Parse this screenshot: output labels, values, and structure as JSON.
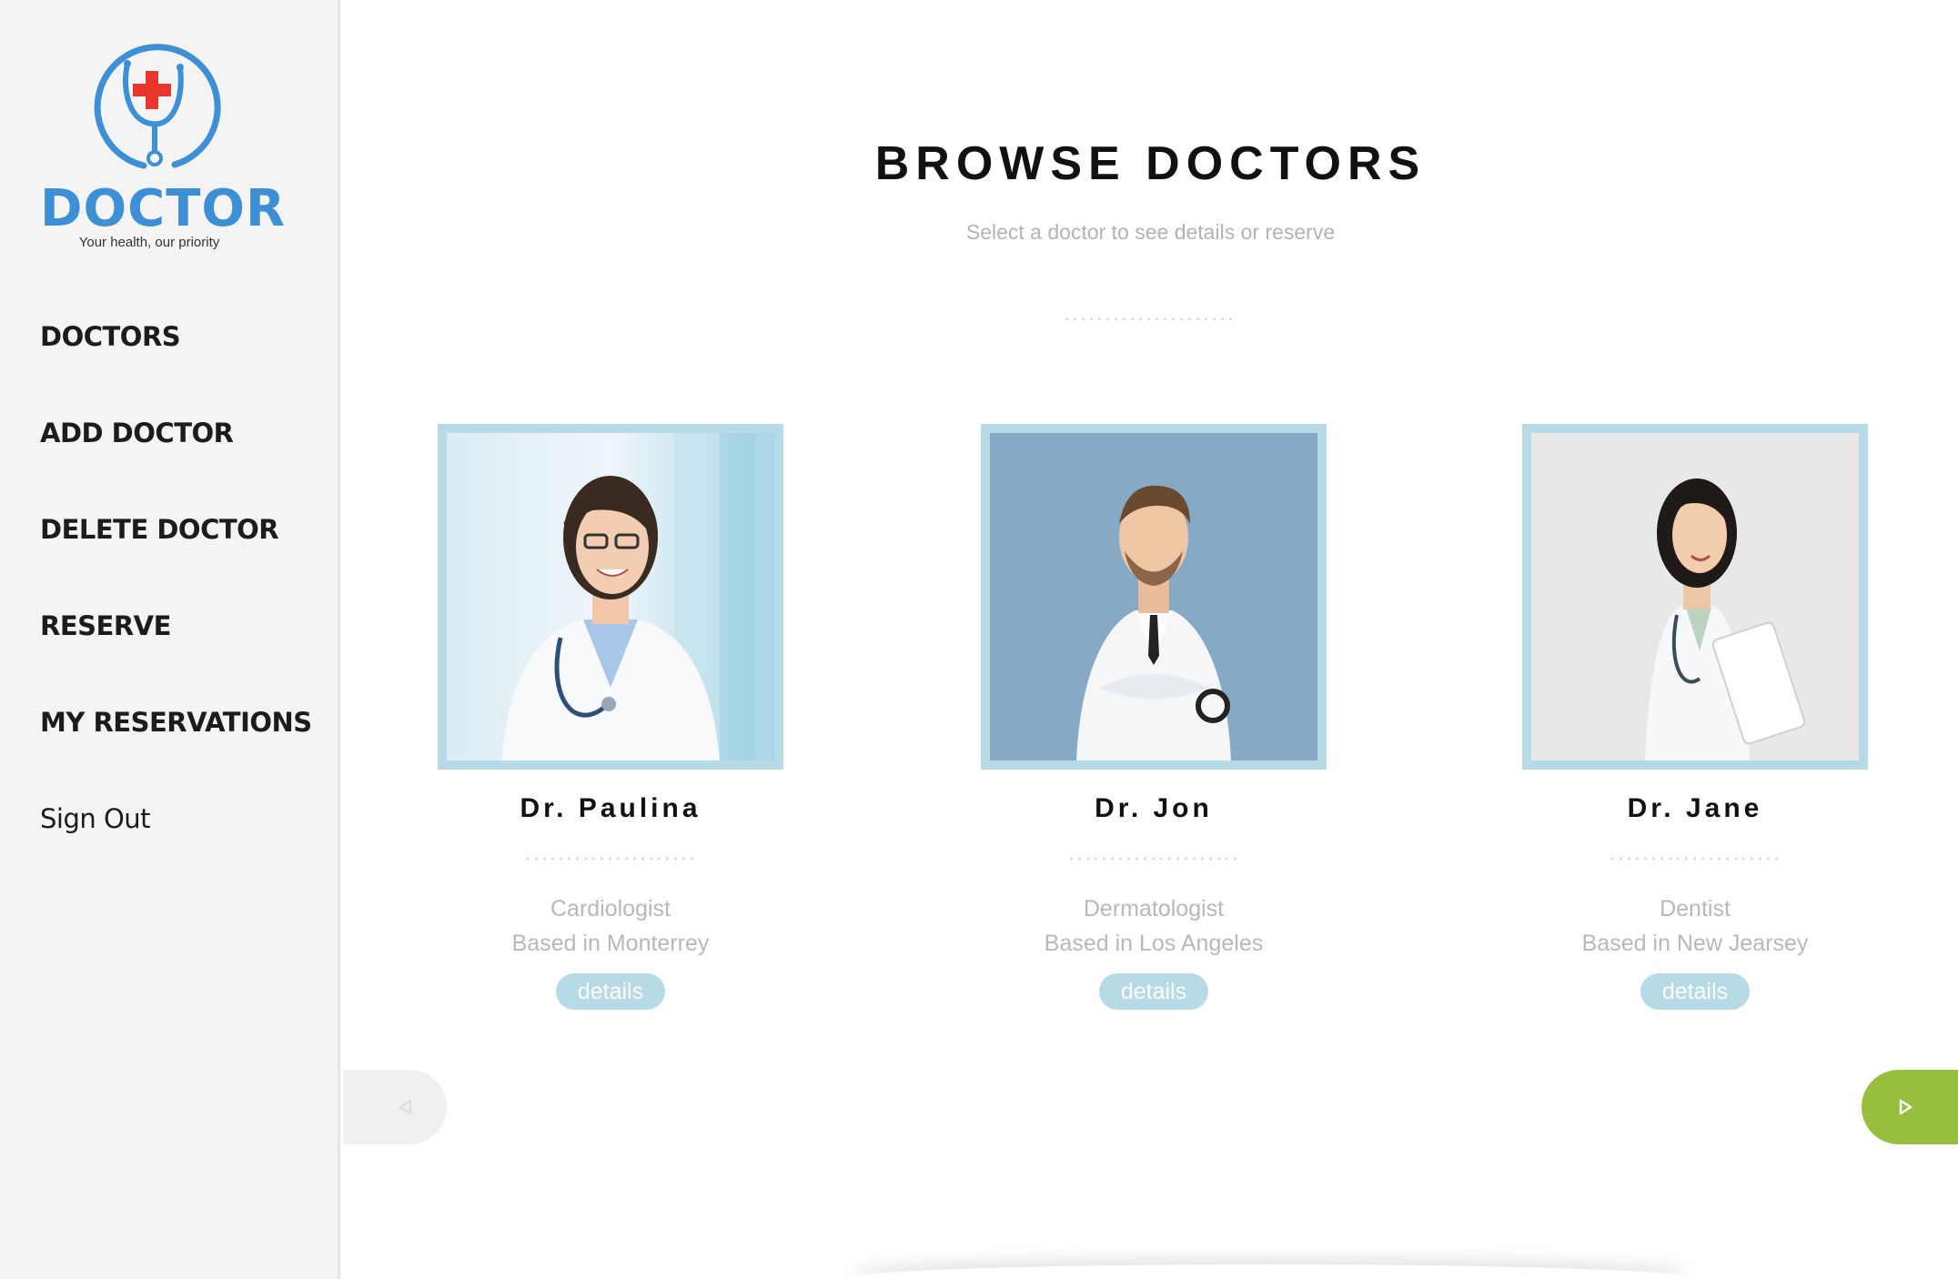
{
  "brand": {
    "name": "DOCTOR",
    "tagline": "Your health, our priority",
    "color": "#3d8fd6",
    "cross_color": "#e8362d"
  },
  "sidebar": {
    "items": [
      {
        "label": "DOCTORS"
      },
      {
        "label": "ADD DOCTOR"
      },
      {
        "label": "DELETE DOCTOR"
      },
      {
        "label": "RESERVE"
      },
      {
        "label": "MY RESERVATIONS"
      },
      {
        "label": "Sign Out"
      }
    ]
  },
  "main": {
    "title": "BROWSE DOCTORS",
    "subtitle": "Select a doctor to see details or reserve",
    "doctors": [
      {
        "name": "Dr. Paulina",
        "specialty": "Cardiologist",
        "location": "Based in Monterrey",
        "details_label": "details"
      },
      {
        "name": "Dr. Jon",
        "specialty": "Dermatologist",
        "location": "Based in Los Angeles",
        "details_label": "details"
      },
      {
        "name": "Dr. Jane",
        "specialty": "Dentist",
        "location": "Based in New Jearsey",
        "details_label": "details"
      }
    ],
    "prev_icon": "triangle-left-icon",
    "next_icon": "triangle-right-icon",
    "accent_color": "#97bf3d",
    "frame_color": "#b7dbe6"
  }
}
